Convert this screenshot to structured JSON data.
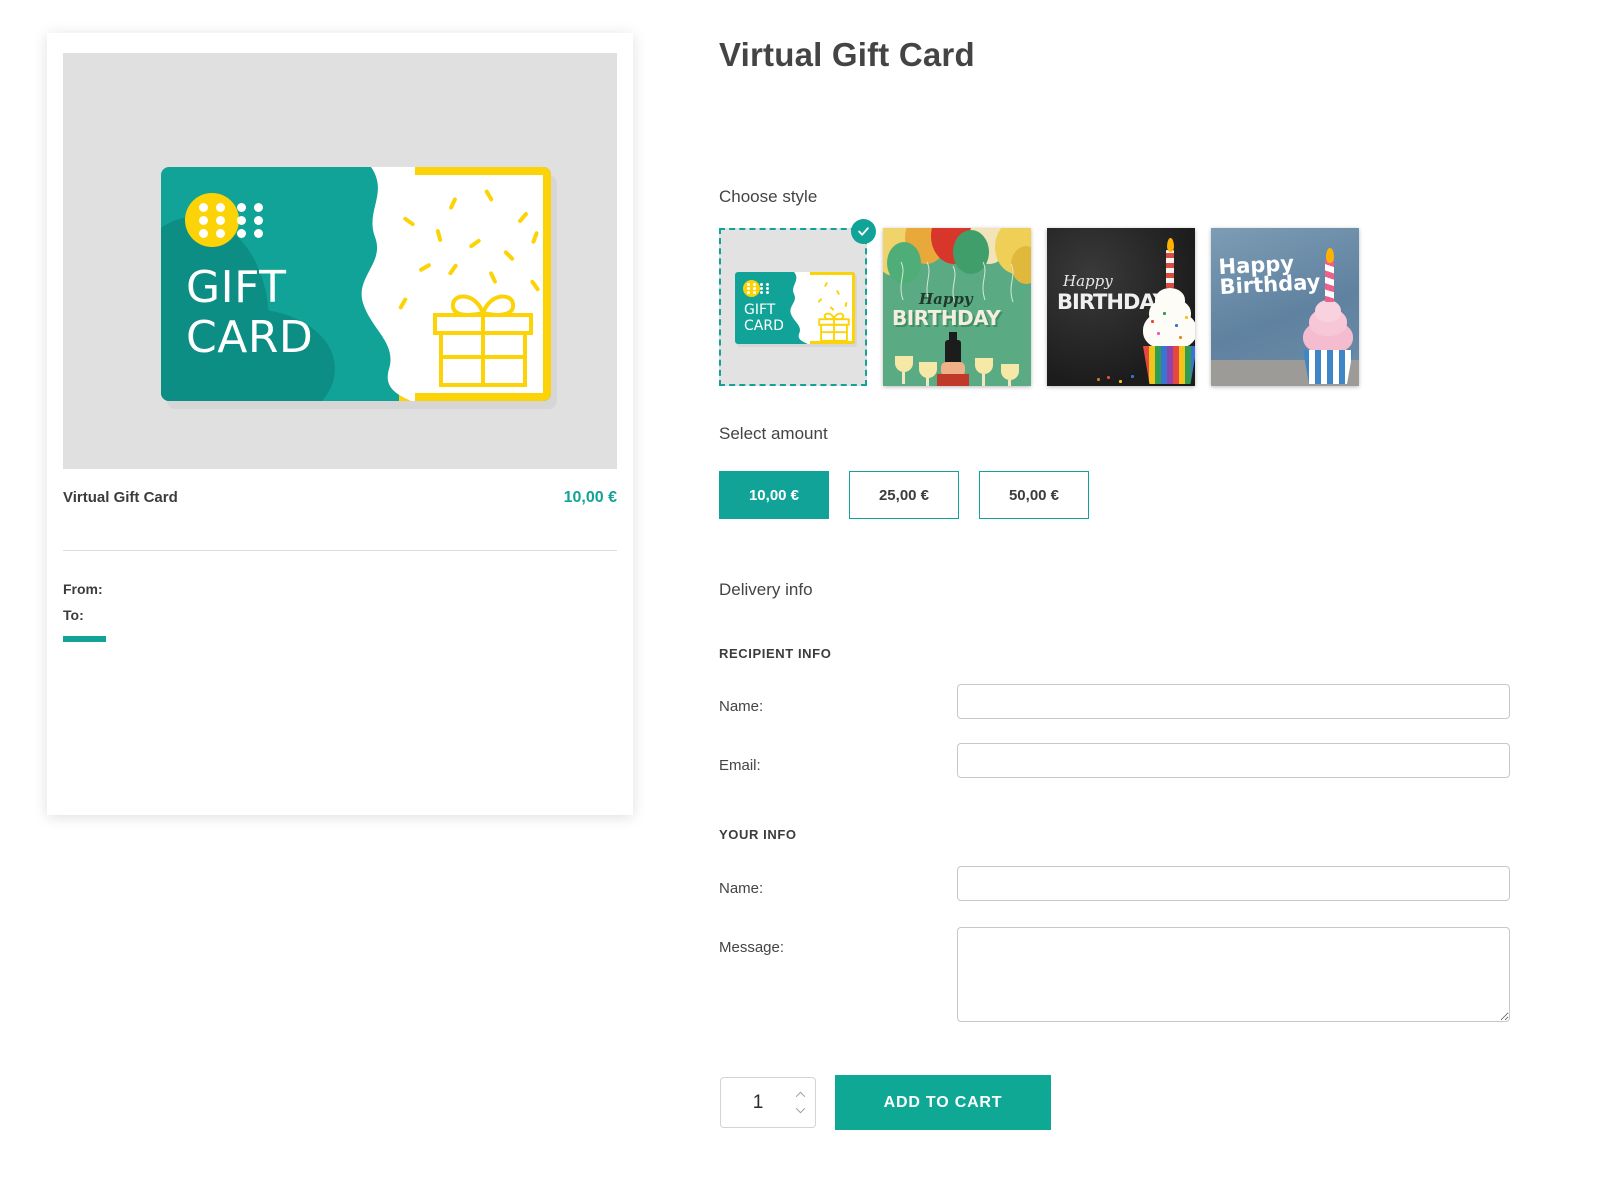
{
  "page": {
    "title": "Virtual Gift Card"
  },
  "preview": {
    "product_name": "Virtual Gift Card",
    "price": "10,00 €",
    "from_label": "From:",
    "to_label": "To:",
    "card_art": {
      "line1": "GIFT",
      "line2": "CARD",
      "teal": "#11a397",
      "yellow": "#fbd307",
      "background": "#e0e0e0"
    }
  },
  "choose_style": {
    "heading": "Choose style",
    "options": [
      {
        "name": "Gift Card illustration",
        "selected": true,
        "kind": "giftcard",
        "line1": "GIFT",
        "line2": "CARD"
      },
      {
        "name": "Balloons Happy Birthday",
        "selected": false,
        "kind": "balloons",
        "script_text": "Happy",
        "block_text": "BIRTHDAY"
      },
      {
        "name": "Chalkboard Happy Birthday",
        "selected": false,
        "kind": "chalkboard",
        "script_text": "Happy",
        "block_text": "BIRTHDAY"
      },
      {
        "name": "Blue Happy Birthday cupcake",
        "selected": false,
        "kind": "blue",
        "script_text": "Happy",
        "block_text": "Birthday"
      }
    ],
    "selected_badge_icon": "check-icon"
  },
  "select_amount": {
    "heading": "Select amount",
    "options": [
      {
        "label": "10,00 €",
        "selected": true
      },
      {
        "label": "25,00 €",
        "selected": false
      },
      {
        "label": "50,00 €",
        "selected": false
      }
    ]
  },
  "delivery_info": {
    "heading": "Delivery info",
    "recipient_section_label": "RECIPIENT INFO",
    "your_section_label": "YOUR INFO",
    "recipient_name_label": "Name:",
    "recipient_name_value": "",
    "recipient_email_label": "Email:",
    "recipient_email_value": "",
    "your_name_label": "Name:",
    "your_name_value": "",
    "message_label": "Message:",
    "message_value": ""
  },
  "cart": {
    "quantity": "1",
    "add_to_cart_label": "ADD TO CART",
    "increment_icon": "chevron-up-icon",
    "decrement_icon": "chevron-down-icon"
  },
  "colors": {
    "accent_teal": "#11a397",
    "button_teal": "#0fa894",
    "accent_yellow": "#fbd307",
    "text_dark": "#3c3c3c",
    "border_grey": "#c8c8c8"
  }
}
